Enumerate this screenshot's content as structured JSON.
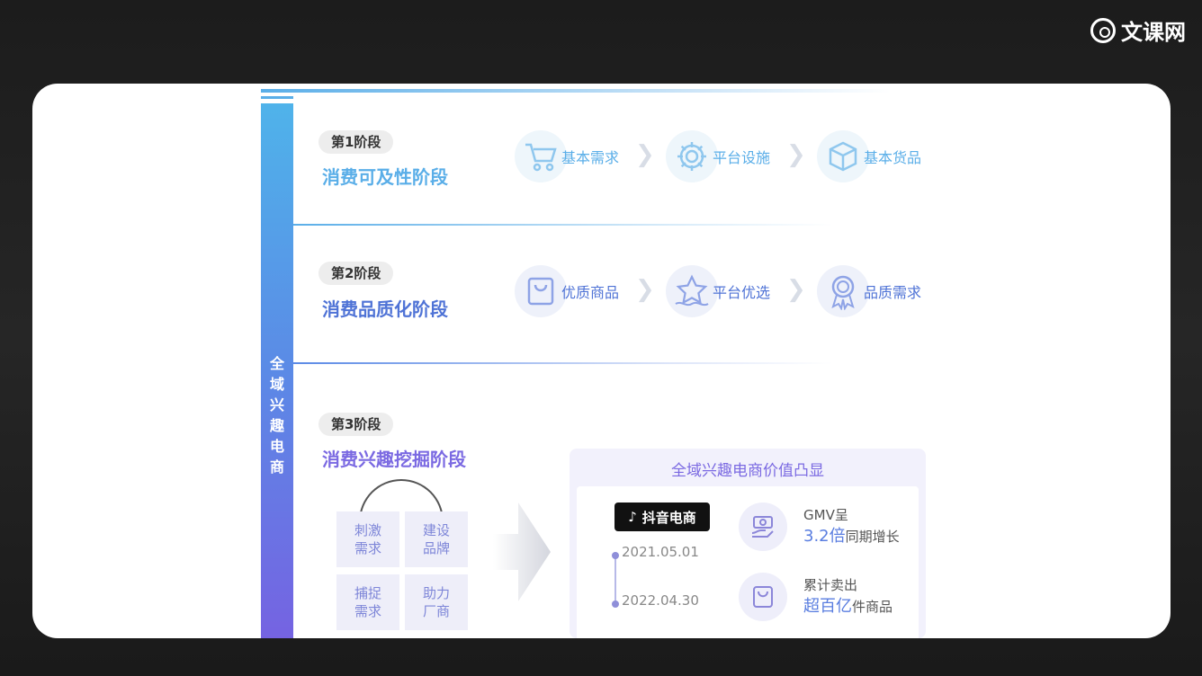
{
  "brand": {
    "logo_text": "文课网"
  },
  "sidebar_label_chars": [
    "全",
    "域",
    "兴",
    "趣",
    "电",
    "商"
  ],
  "stage1": {
    "badge": "第1阶段",
    "title": "消费可及性阶段",
    "steps": [
      {
        "label": "基本需求",
        "icon": "shopping-cart-icon"
      },
      {
        "label": "平台设施",
        "icon": "gear-icon"
      },
      {
        "label": "基本货品",
        "icon": "box-icon"
      }
    ]
  },
  "stage2": {
    "badge": "第2阶段",
    "title": "消费品质化阶段",
    "steps": [
      {
        "label": "优质商品",
        "icon": "shopping-bag-icon"
      },
      {
        "label": "平台优选",
        "icon": "star-icon"
      },
      {
        "label": "品质需求",
        "icon": "award-badge-icon"
      }
    ]
  },
  "stage3": {
    "badge": "第3阶段",
    "title": "消费兴趣挖掘阶段",
    "puzzle": [
      "刺激需求",
      "建设品牌",
      "捕捉需求",
      "助力厂商"
    ],
    "panel": {
      "title": "全域兴趣电商价值凸显",
      "platform": "抖音电商",
      "date_start": "2021.05.01",
      "date_end": "2022.04.30",
      "stat1_line1": "GMV呈",
      "stat1_highlight": "3.2倍",
      "stat1_suffix": "同期增长",
      "stat2_line1": "累计卖出",
      "stat2_highlight": "超百亿",
      "stat2_suffix": "件商品"
    }
  },
  "colors": {
    "stage1": "#5aaee8",
    "stage2": "#4f73d6",
    "stage3": "#7b6ae2"
  }
}
